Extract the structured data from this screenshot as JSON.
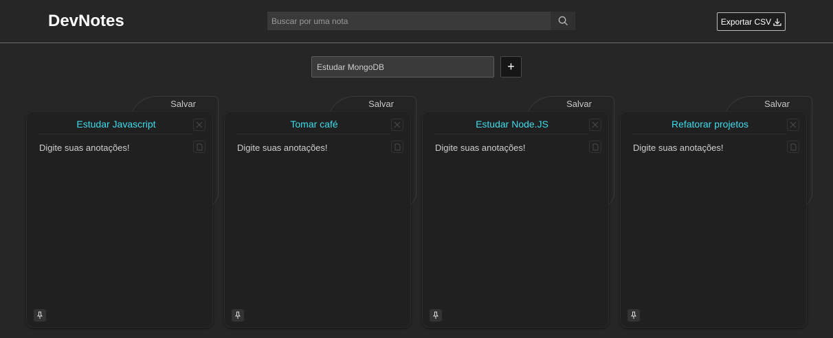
{
  "app": {
    "title": "DevNotes"
  },
  "search": {
    "placeholder": "Buscar por uma nota"
  },
  "export": {
    "label": "Exportar CSV"
  },
  "new_note": {
    "value": "Estudar MongoDB",
    "add_label": "+"
  },
  "notes": [
    {
      "title": "Estudar Javascript",
      "body": "Digite suas anotações!",
      "save_label": "Salvar"
    },
    {
      "title": "Tomar café",
      "body": "Digite suas anotações!",
      "save_label": "Salvar"
    },
    {
      "title": "Estudar Node.JS",
      "body": "Digite suas anotações!",
      "save_label": "Salvar"
    },
    {
      "title": "Refatorar projetos",
      "body": "Digite suas anotações!",
      "save_label": "Salvar"
    }
  ],
  "colors": {
    "accent": "#3fdcec",
    "background": "#262626",
    "card": "#202020"
  },
  "icons": {
    "search": "search-icon",
    "download": "download-icon",
    "close": "close-icon",
    "file": "file-icon",
    "pin": "pin-icon"
  }
}
